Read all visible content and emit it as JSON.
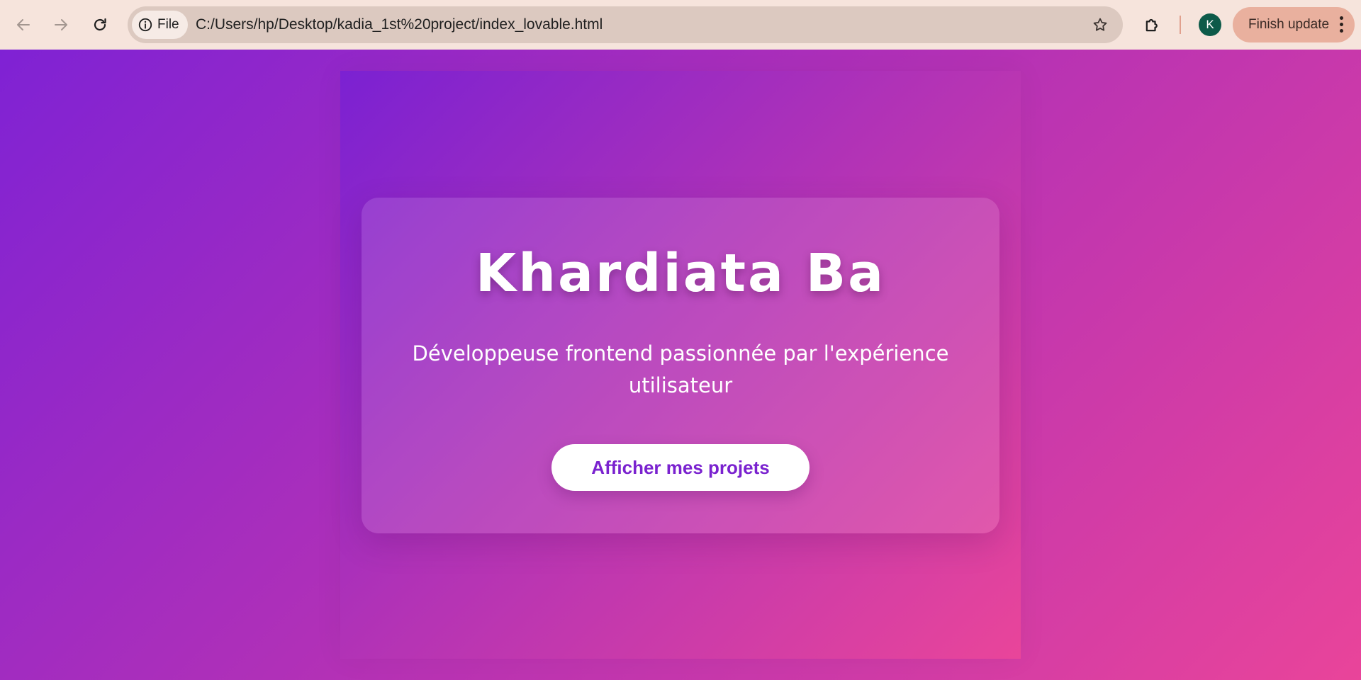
{
  "browser": {
    "site_chip_label": "File",
    "url": "C:/Users/hp/Desktop/kadia_1st%20project/index_lovable.html",
    "profile_initial": "K",
    "update_label": "Finish update",
    "icons": {
      "back": "arrow-left-icon",
      "forward": "arrow-right-icon",
      "reload": "reload-icon",
      "site_info": "info-icon",
      "bookmark": "star-icon",
      "extensions": "puzzle-icon",
      "menu": "kebab-icon"
    },
    "colors": {
      "toolbar": "#f6e4dc",
      "omnibox": "#dcc9c0",
      "update_button": "#e9b09e",
      "avatar": "#0d5a49"
    }
  },
  "page": {
    "title": "Khardiata Ba",
    "subtitle": "Développeuse frontend passionnée par l'expérience utilisateur",
    "cta_label": "Afficher mes projets",
    "colors": {
      "gradient_start": "#7f22d4",
      "gradient_mid": "#b331b6",
      "gradient_end": "#e9449a",
      "cta_text": "#7a22cf"
    }
  }
}
